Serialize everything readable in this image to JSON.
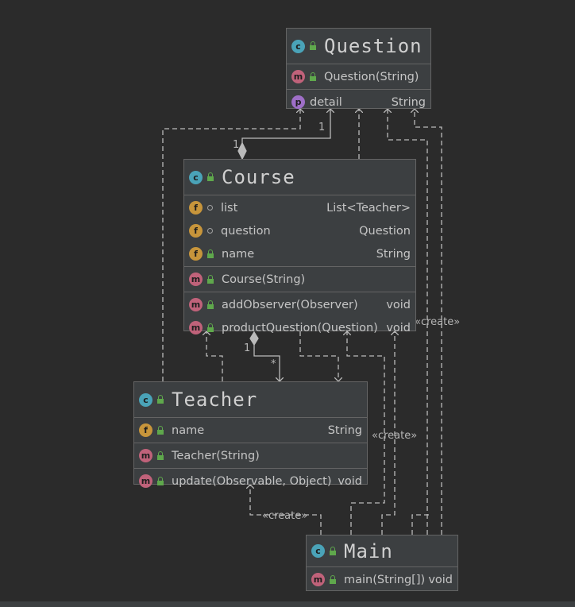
{
  "classes": {
    "question": {
      "name": "Question",
      "constructor": "Question(String)",
      "fields": [
        {
          "name": "detail",
          "type": "String",
          "kind": "p"
        }
      ]
    },
    "course": {
      "name": "Course",
      "fields": [
        {
          "name": "list",
          "type": "List<Teacher>"
        },
        {
          "name": "question",
          "type": "Question"
        },
        {
          "name": "name",
          "type": "String"
        }
      ],
      "constructor": "Course(String)",
      "methods": [
        {
          "name": "addObserver(Observer)",
          "type": "void"
        },
        {
          "name": "productQuestion(Question)",
          "type": "void"
        }
      ]
    },
    "teacher": {
      "name": "Teacher",
      "fields": [
        {
          "name": "name",
          "type": "String"
        }
      ],
      "constructor": "Teacher(String)",
      "methods": [
        {
          "name": "update(Observable, Object)",
          "type": "void"
        }
      ]
    },
    "main": {
      "name": "Main",
      "methods": [
        {
          "name": "main(String[])",
          "type": "void"
        }
      ]
    }
  },
  "badges": {
    "class": "c",
    "method": "m",
    "field": "f",
    "property": "p"
  },
  "labels": {
    "multiplicity_one": "1",
    "multiplicity_many": "*",
    "create": "«create»"
  },
  "colors": {
    "background": "#2b2b2b",
    "box": "#3c3f41",
    "edge": "#bbbbbb",
    "class_badge": "#4aa3b8",
    "method_badge": "#c0627a",
    "field_badge": "#c7953b",
    "property_badge": "#9e6fc7",
    "public_lock": "#5fa84c"
  }
}
